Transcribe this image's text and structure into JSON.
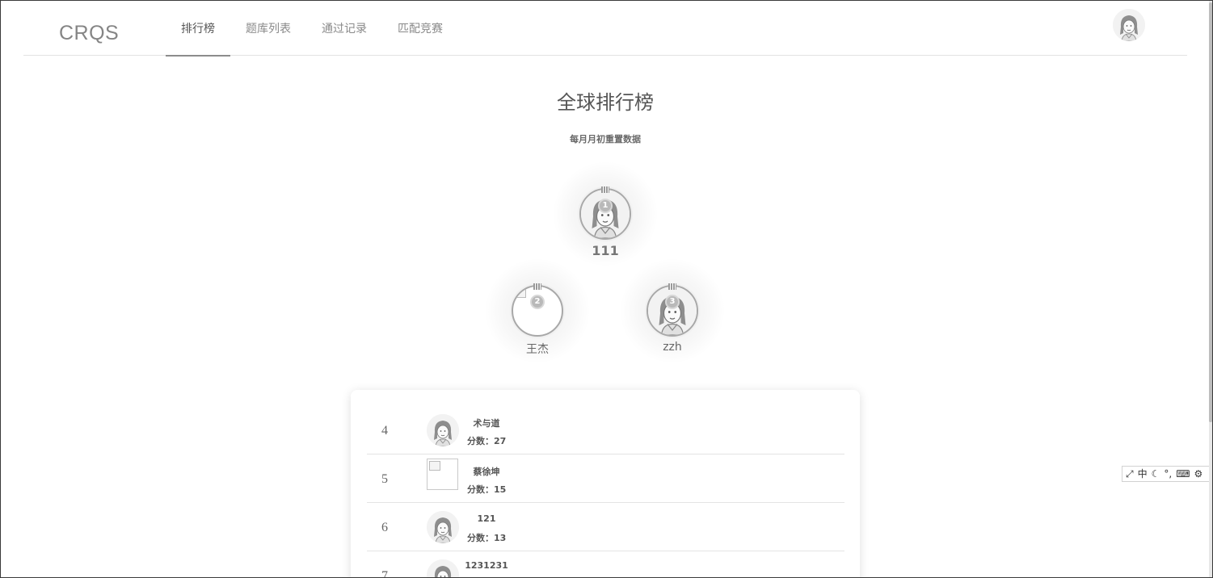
{
  "app": {
    "logo": "CRQS"
  },
  "nav": {
    "items": [
      {
        "label": "排行榜",
        "active": true
      },
      {
        "label": "题库列表",
        "active": false
      },
      {
        "label": "通过记录",
        "active": false
      },
      {
        "label": "匹配竞赛",
        "active": false
      }
    ]
  },
  "page": {
    "title": "全球排行榜",
    "subtitle": "每月月初重置数据"
  },
  "podium": {
    "first": {
      "rank": "1",
      "name": "111"
    },
    "second": {
      "rank": "2",
      "name": "王杰"
    },
    "third": {
      "rank": "3",
      "name": "zzh"
    }
  },
  "ranking": {
    "rows": [
      {
        "rank": "4",
        "name": "术与道",
        "score": "分数：27"
      },
      {
        "rank": "5",
        "name": "蔡徐坤",
        "score": "分数：15"
      },
      {
        "rank": "6",
        "name": "121",
        "score": "分数：13"
      },
      {
        "rank": "7",
        "name": "1231231",
        "score": ""
      }
    ]
  },
  "ime": {
    "mode": "中",
    "icons": [
      "expand-icon",
      "moon-icon",
      "punctuation-icon",
      "keyboard-icon",
      "settings-icon"
    ]
  },
  "colors": {
    "border": "#3a3a3a",
    "text": "#555555",
    "muted": "#8a8a8a",
    "divider": "#e2e2e2"
  }
}
